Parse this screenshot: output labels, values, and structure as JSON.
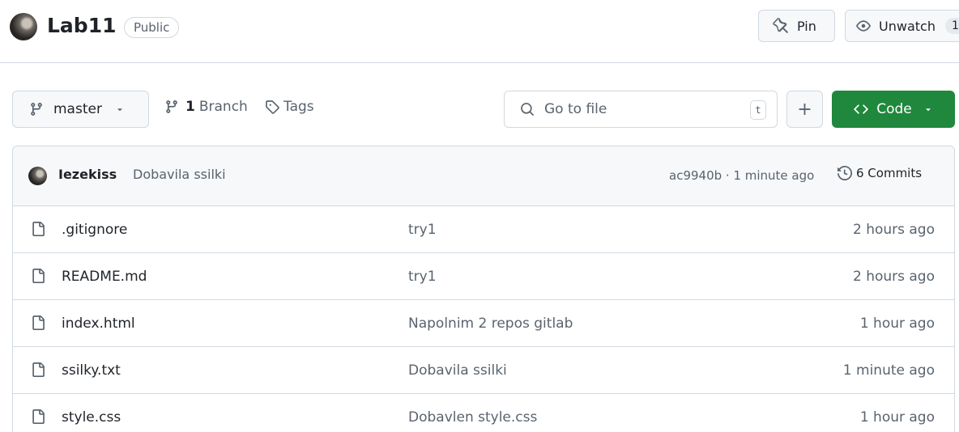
{
  "repo": {
    "name": "Lab11",
    "visibility": "Public"
  },
  "header_actions": {
    "pin_label": "Pin",
    "unwatch_label": "Unwatch",
    "watch_count": "1"
  },
  "toolbar": {
    "branch": "master",
    "branch_count": "1",
    "branch_word": "Branch",
    "tags_label": "Tags",
    "goto_placeholder": "Go to file",
    "goto_shortcut": "t",
    "add_label": "+",
    "code_label": "Code"
  },
  "latest_commit": {
    "author": "Iezekiss",
    "message": "Dobavila ssilki",
    "meta": "ac9940b · 1 minute ago",
    "commits_label": "6 Commits"
  },
  "files": [
    {
      "name": ".gitignore",
      "commit": "try1",
      "time": "2 hours ago"
    },
    {
      "name": "README.md",
      "commit": "try1",
      "time": "2 hours ago"
    },
    {
      "name": "index.html",
      "commit": "Napolnim 2 repos gitlab",
      "time": "1 hour ago"
    },
    {
      "name": "ssilky.txt",
      "commit": "Dobavila ssilki",
      "time": "1 minute ago"
    },
    {
      "name": "style.css",
      "commit": "Dobavlen style.css",
      "time": "1 hour ago"
    }
  ],
  "colors": {
    "code_button": "#1f883d",
    "border": "#d1d9e0",
    "muted_text": "#59636e"
  }
}
